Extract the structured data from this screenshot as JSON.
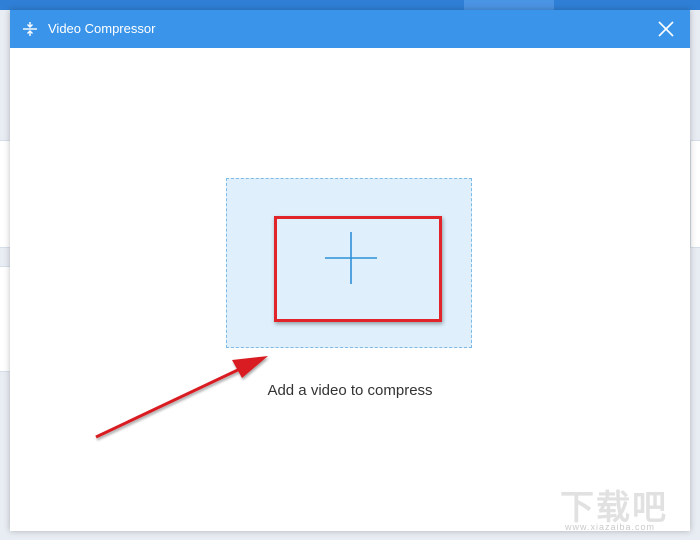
{
  "window": {
    "title": "Video Compressor",
    "close_icon": "close-icon",
    "title_icon": "compress-icon"
  },
  "drop_zone": {
    "label": "Add a video to compress",
    "icon": "plus-icon"
  },
  "watermark": {
    "text": "下载吧",
    "url": "www.xiazaiba.com"
  },
  "colors": {
    "title_bar": "#3a95ea",
    "drop_zone_bg": "#dff0fc",
    "drop_zone_border": "#7dbbe6",
    "highlight": "#e0242a",
    "arrow": "#d81e22"
  }
}
